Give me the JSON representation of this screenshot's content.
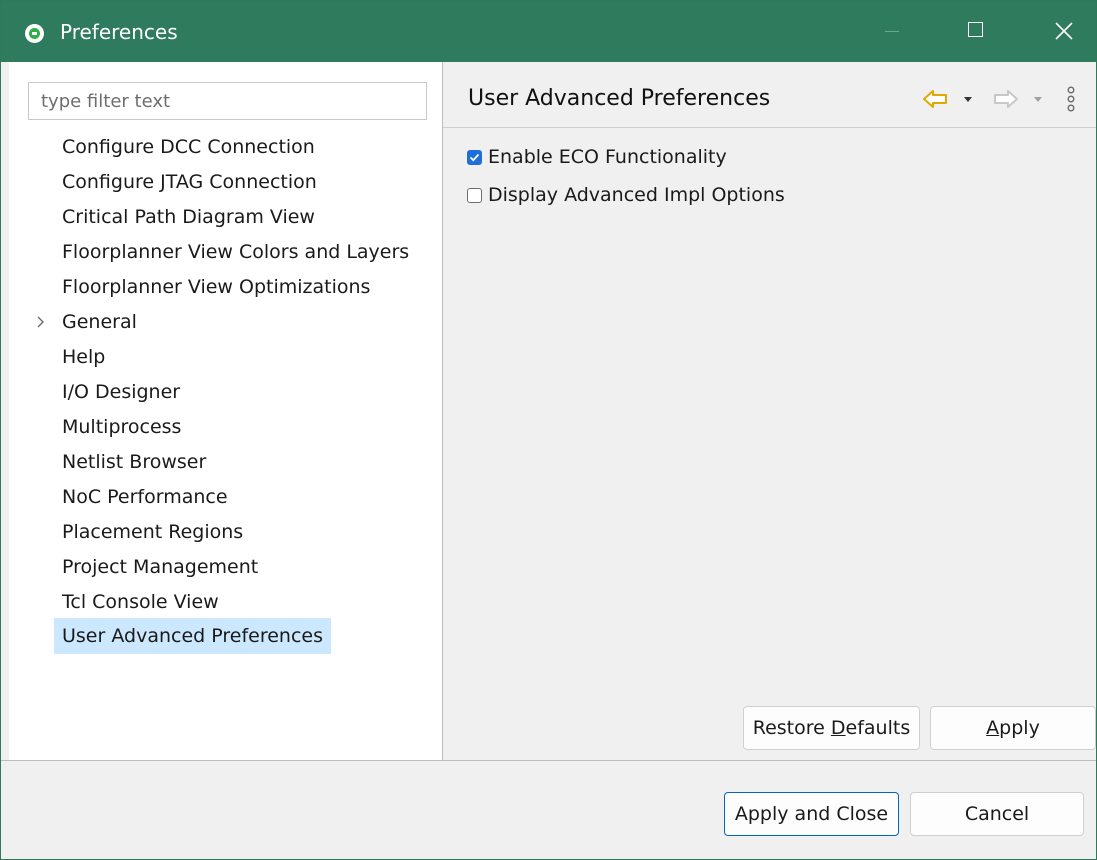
{
  "window": {
    "title": "Preferences",
    "accent_color": "#2f7b5d"
  },
  "filter": {
    "placeholder": "type filter text",
    "value": ""
  },
  "tree": {
    "items": [
      {
        "label": "Configure DCC Connection",
        "expandable": false,
        "selected": false
      },
      {
        "label": "Configure JTAG Connection",
        "expandable": false,
        "selected": false
      },
      {
        "label": "Critical Path Diagram View",
        "expandable": false,
        "selected": false
      },
      {
        "label": "Floorplanner View Colors and Layers",
        "expandable": false,
        "selected": false
      },
      {
        "label": "Floorplanner View Optimizations",
        "expandable": false,
        "selected": false
      },
      {
        "label": "General",
        "expandable": true,
        "selected": false
      },
      {
        "label": "Help",
        "expandable": false,
        "selected": false
      },
      {
        "label": "I/O Designer",
        "expandable": false,
        "selected": false
      },
      {
        "label": "Multiprocess",
        "expandable": false,
        "selected": false
      },
      {
        "label": "Netlist Browser",
        "expandable": false,
        "selected": false
      },
      {
        "label": "NoC Performance",
        "expandable": false,
        "selected": false
      },
      {
        "label": "Placement Regions",
        "expandable": false,
        "selected": false
      },
      {
        "label": "Project Management",
        "expandable": false,
        "selected": false
      },
      {
        "label": "Tcl Console View",
        "expandable": false,
        "selected": false
      },
      {
        "label": "User Advanced Preferences",
        "expandable": false,
        "selected": true
      }
    ]
  },
  "page": {
    "title": "User Advanced Preferences",
    "options": [
      {
        "label": "Enable ECO Functionality",
        "checked": true
      },
      {
        "label": "Display Advanced Impl Options",
        "checked": false
      }
    ],
    "restore_defaults": {
      "pre": "Restore ",
      "mnemonic": "D",
      "post": "efaults"
    },
    "apply": {
      "pre": "",
      "mnemonic": "A",
      "post": "pply"
    }
  },
  "footer": {
    "apply_and_close": "Apply and Close",
    "cancel": "Cancel"
  },
  "icons": {
    "back": "back-arrow-icon",
    "forward": "forward-arrow-icon",
    "menu": "view-menu-icon"
  }
}
